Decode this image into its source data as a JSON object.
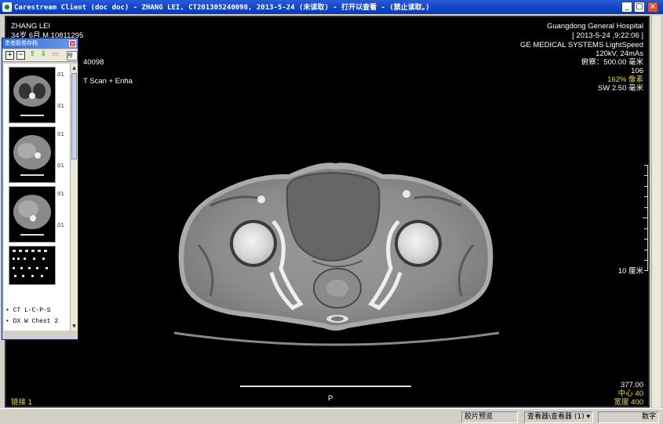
{
  "window": {
    "title": "Carestream Client (doc doc) - ZHANG LEI, CT201305240098, 2013-5-24 (未读取) - 打开以查看 - (禁止读取。)"
  },
  "thumbnail_panel": {
    "title": "患者胶卷存档",
    "dropdown_value": "所",
    "thumb_numbers": [
      "01",
      "01",
      "01",
      "01",
      "01",
      "01"
    ],
    "series": [
      "• CT L-C-P-S",
      "• DX W Chest 2"
    ]
  },
  "overlay": {
    "top_left": {
      "patient_name": "ZHANG LEI",
      "patient_info": "34岁 6月,M,10811295",
      "accession_suffix": "40098",
      "study_desc": "T Scan + Enha"
    },
    "top_right": {
      "hospital": "Guangdong General Hospital",
      "datetime": "[ 2013-5-24 ,9:22:06 ]",
      "device": "GE MEDICAL SYSTEMS LightSpeed",
      "exposure": "120kV, 24mAs",
      "fov": "俯察：500.00 毫米",
      "image_num": "106",
      "zoom": "162% 像素",
      "slice": "SW 2.50 毫米"
    },
    "scale_label": "10 厘米",
    "bottom_right": {
      "location": "377.00",
      "center": "中心  40",
      "width": "宽度 400"
    },
    "orientation_bottom": "P",
    "bottom_left": "链接 1"
  },
  "statusbar": {
    "preview": "胶片预览",
    "viewer": "查看器\\查看器 (1) ▾",
    "mode": "数字"
  },
  "colors": {
    "titlebar": "#1447c8",
    "overlay_text": "#ffffff",
    "overlay_highlight": "#e8d850",
    "viewer_bg": "#000000"
  }
}
